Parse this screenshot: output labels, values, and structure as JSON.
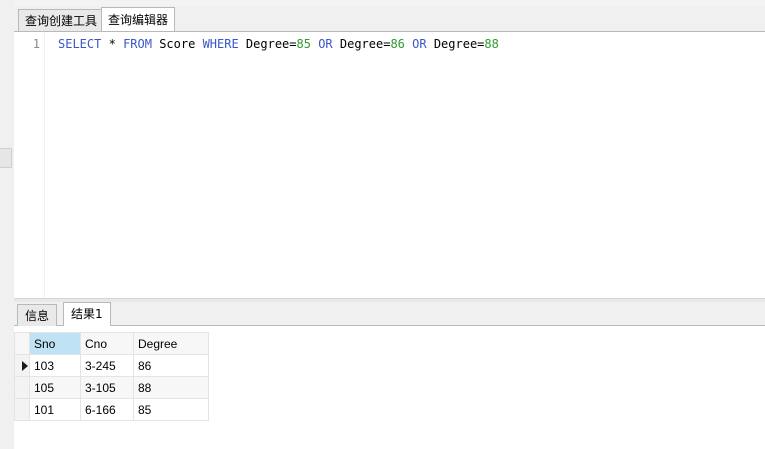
{
  "tabs": {
    "query_builder": "查询创建工具",
    "query_editor": "查询编辑器"
  },
  "editor": {
    "line_number": "1",
    "tokens": [
      "SELECT",
      "*",
      "FROM",
      "Score",
      "WHERE",
      "Degree=",
      "85",
      "OR",
      "Degree=",
      "86",
      "OR",
      "Degree=",
      "88"
    ]
  },
  "result_tabs": {
    "info": "信息",
    "result1": "结果1"
  },
  "grid": {
    "columns": [
      "Sno",
      "Cno",
      "Degree"
    ],
    "rows": [
      [
        "103",
        "3-245",
        "86"
      ],
      [
        "105",
        "3-105",
        "88"
      ],
      [
        "101",
        "6-166",
        "85"
      ]
    ]
  },
  "colors": {
    "keyword": "#3b56c9",
    "number": "#2e9a2e",
    "selected_header": "#bfe3f5"
  }
}
